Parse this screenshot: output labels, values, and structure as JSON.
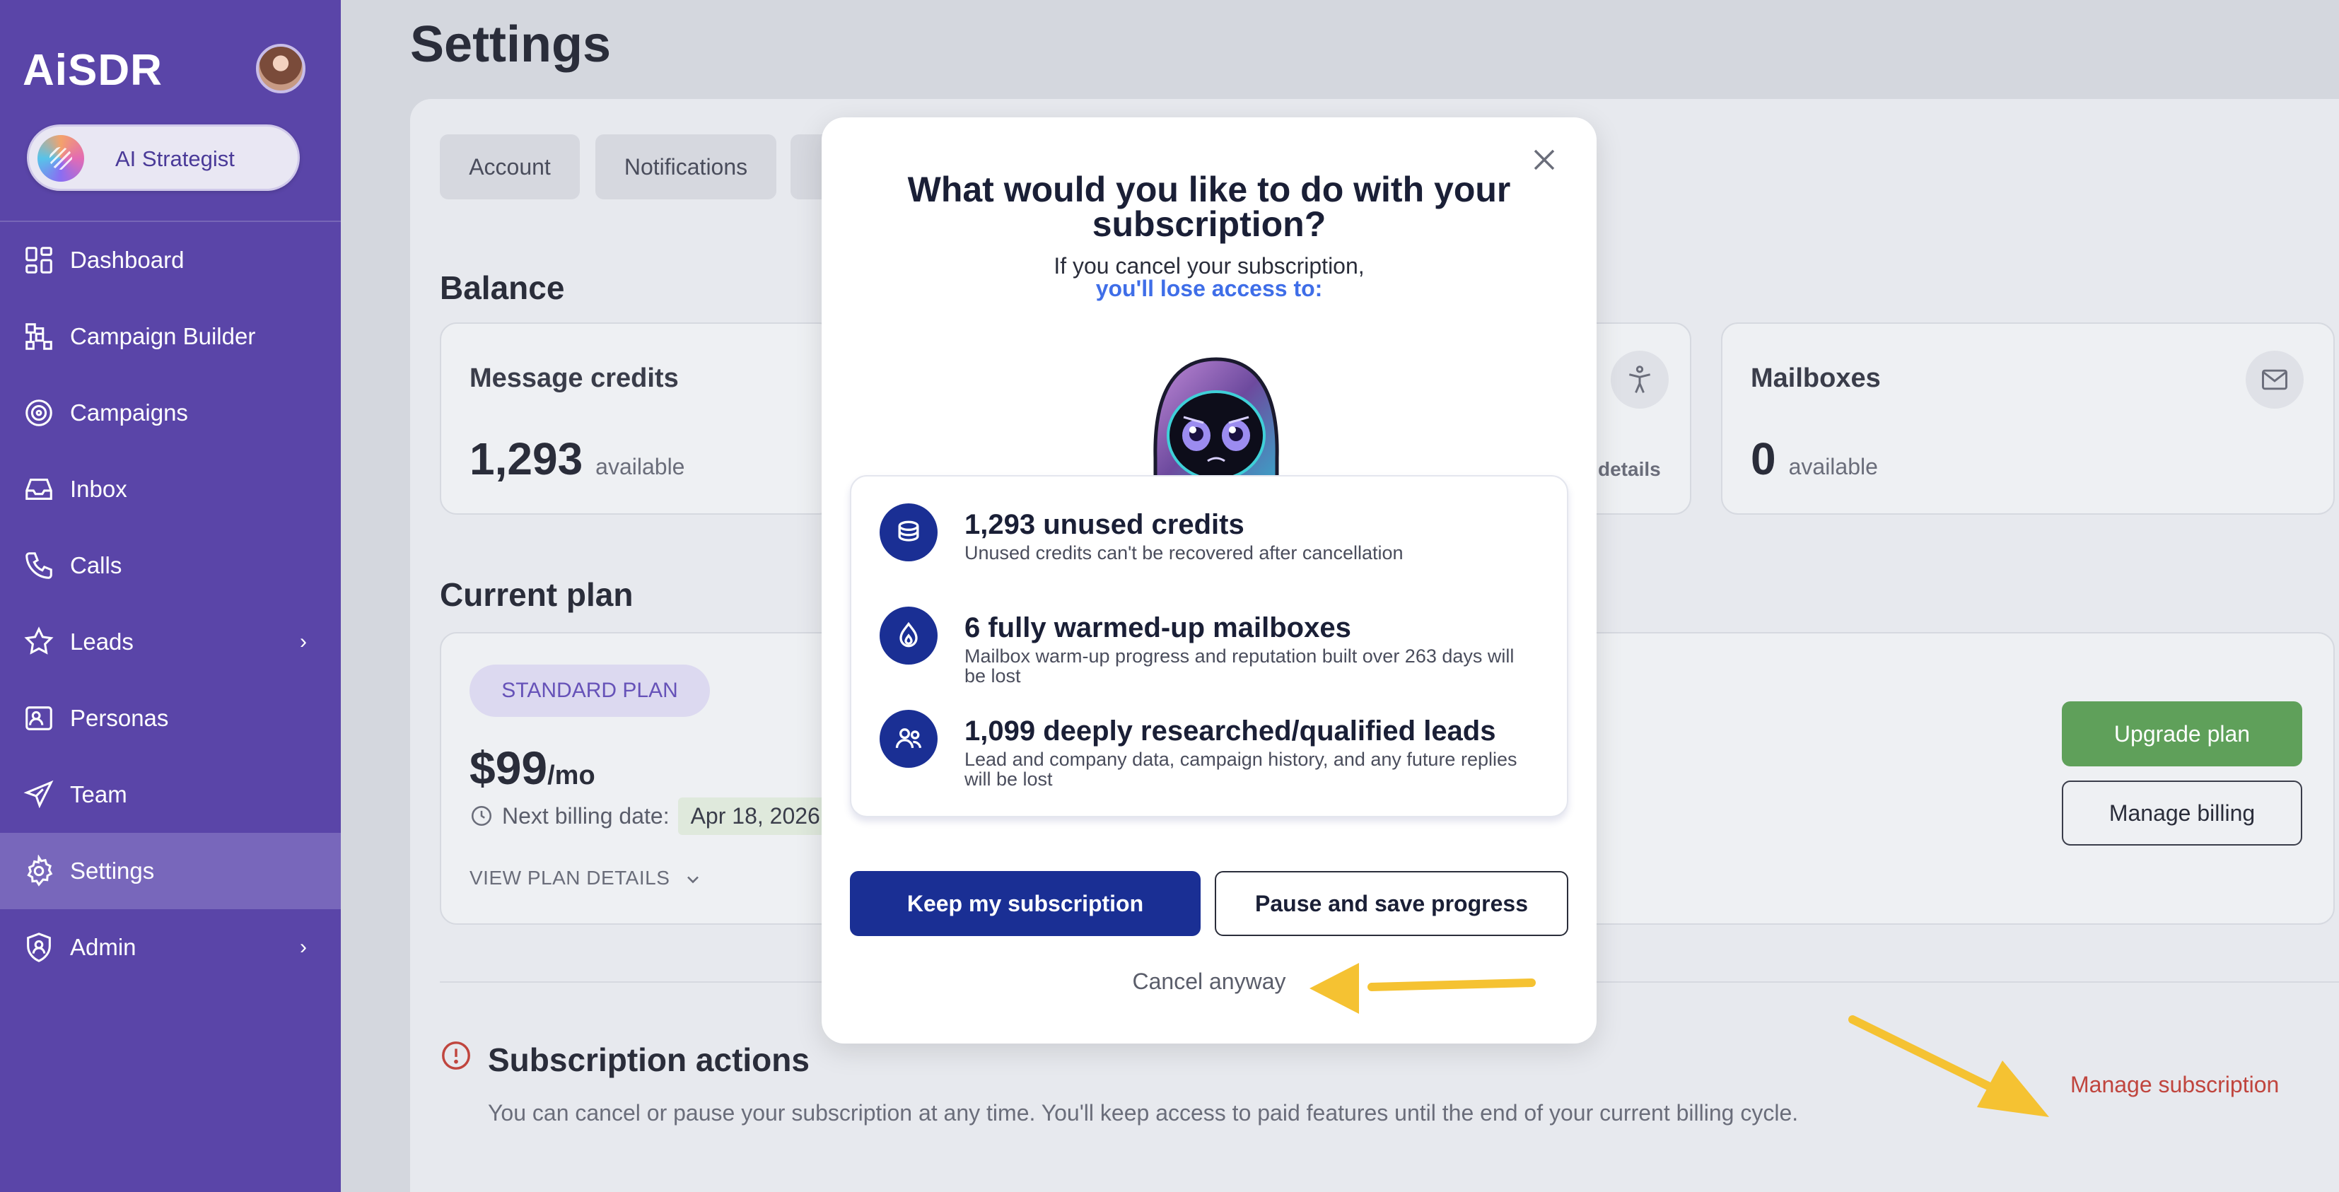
{
  "sidebar": {
    "logo": "AiSDR",
    "strategist_label": "AI Strategist",
    "items": [
      {
        "label": "Dashboard",
        "icon": "dashboard-icon"
      },
      {
        "label": "Campaign Builder",
        "icon": "campaign-builder-icon"
      },
      {
        "label": "Campaigns",
        "icon": "target-icon"
      },
      {
        "label": "Inbox",
        "icon": "inbox-icon"
      },
      {
        "label": "Calls",
        "icon": "phone-icon"
      },
      {
        "label": "Leads",
        "icon": "star-person-icon",
        "has_submenu": true
      },
      {
        "label": "Personas",
        "icon": "persona-icon"
      },
      {
        "label": "Team",
        "icon": "send-icon"
      },
      {
        "label": "Settings",
        "icon": "gear-icon",
        "active": true
      },
      {
        "label": "Admin",
        "icon": "shield-user-icon",
        "has_submenu": true
      }
    ],
    "chevron": "›"
  },
  "page": {
    "title": "Settings",
    "tabs": [
      "Account",
      "Notifications"
    ]
  },
  "balance": {
    "title": "Balance",
    "message_credits": {
      "title": "Message credits",
      "value": "1,293",
      "unit": "available"
    },
    "partial_details": "details",
    "mailboxes": {
      "title": "Mailboxes",
      "value": "0",
      "unit": "available"
    }
  },
  "current_plan": {
    "title": "Current plan",
    "badge": "STANDARD PLAN",
    "price": "$99",
    "period": "/mo",
    "billing_label": "Next billing date:",
    "billing_date": "Apr 18, 2026",
    "view_details": "VIEW PLAN DETAILS",
    "upgrade_button": "Upgrade plan",
    "manage_billing_button": "Manage billing"
  },
  "subscription_actions": {
    "title": "Subscription actions",
    "description": "You can cancel or pause your subscription at any time. You'll keep access to paid features until the end of your current billing cycle.",
    "manage_link": "Manage subscription"
  },
  "modal": {
    "title": "What would you like to do with your subscription?",
    "subtitle": "If you cancel your subscription,",
    "subtitle_highlight": "you'll lose access to:",
    "items": [
      {
        "title": "1,293 unused credits",
        "description": "Unused credits can't be recovered after cancellation",
        "icon": "coins-icon"
      },
      {
        "title": "6 fully warmed-up mailboxes",
        "description": "Mailbox warm-up progress and reputation built over 263 days will be lost",
        "icon": "flame-drop-icon"
      },
      {
        "title": "1,099 deeply researched/qualified leads",
        "description": "Lead and company data, campaign history, and any future replies will be lost",
        "icon": "users-icon"
      }
    ],
    "keep_button": "Keep my subscription",
    "pause_button": "Pause and save progress",
    "cancel_link": "Cancel anyway"
  },
  "colors": {
    "sidebar": "#5a45a8",
    "primary_blue": "#1a2f94",
    "accent_link": "#3f6ee8",
    "upgrade_green": "#5fa05a",
    "danger_red": "#c0453e",
    "annotation_arrow": "#f5c232"
  }
}
